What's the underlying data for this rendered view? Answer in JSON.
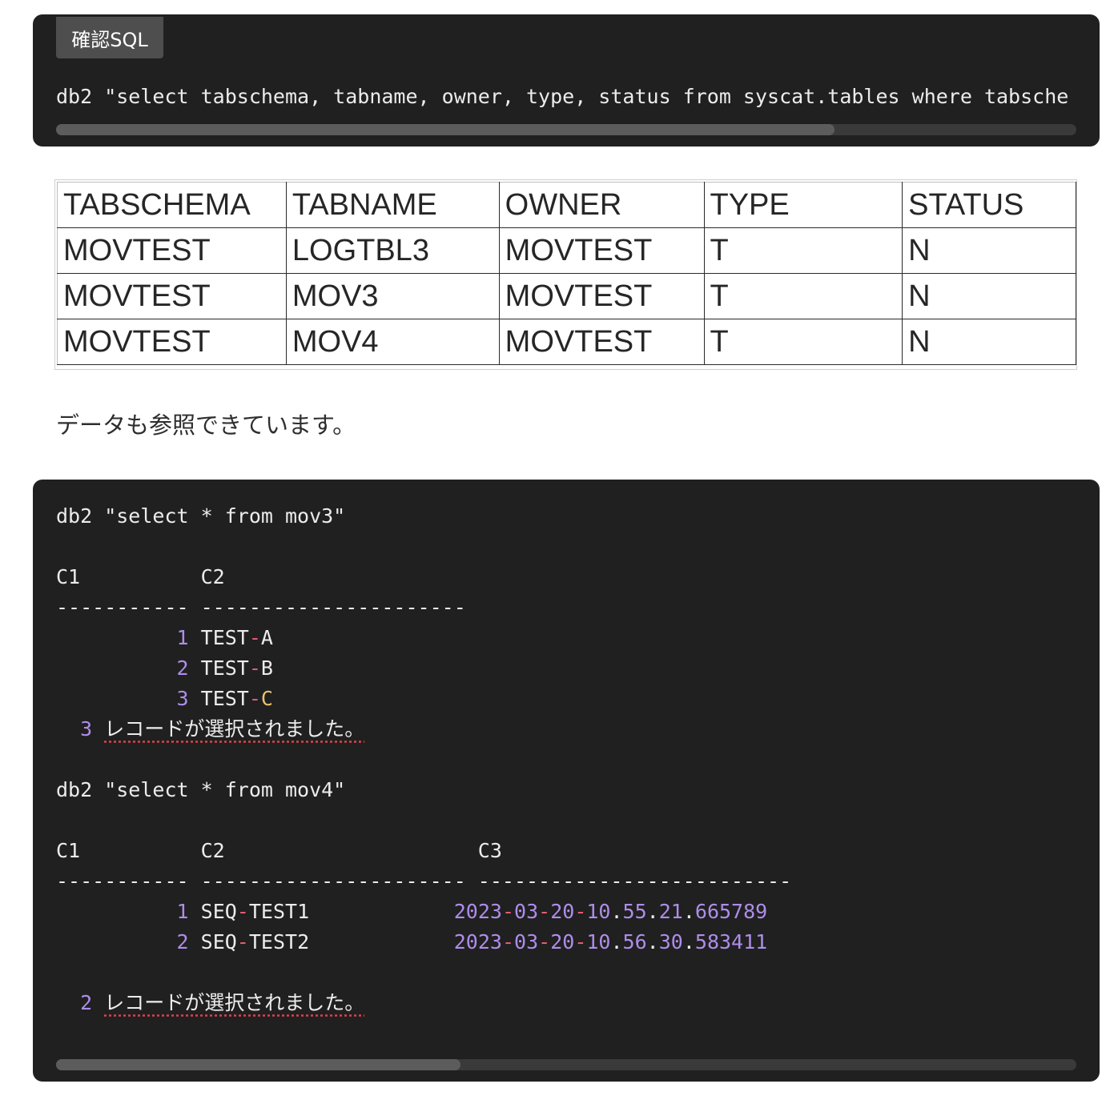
{
  "block1": {
    "label": "確認SQL",
    "code": "db2 \"select tabschema, tabname, owner, type, status from syscat.tables where tabsche"
  },
  "result_table": {
    "headers": [
      "TABSCHEMA",
      "TABNAME",
      "OWNER",
      "TYPE",
      "STATUS"
    ],
    "rows": [
      [
        "MOVTEST",
        "LOGTBL3",
        "MOVTEST",
        "T",
        "N"
      ],
      [
        "MOVTEST",
        "MOV3",
        "MOVTEST",
        "T",
        "N"
      ],
      [
        "MOVTEST",
        "MOV4",
        "MOVTEST",
        "T",
        "N"
      ]
    ]
  },
  "note": "データも参照できています。",
  "block2": {
    "query1": "db2 \"select * from mov3\"",
    "q1_header": "C1          C2",
    "q1_rule": "----------- ----------------------",
    "q1_rows": [
      {
        "num": "1",
        "prefix": "TEST",
        "suffix": "A"
      },
      {
        "num": "2",
        "prefix": "TEST",
        "suffix": "B"
      },
      {
        "num": "3",
        "prefix": "TEST",
        "suffix": "C"
      }
    ],
    "q1_count": "3",
    "q1_msg": "レコードが選択されました。",
    "query2": "db2 \"select * from mov4\"",
    "q2_header": "C1          C2                     C3",
    "q2_rule": "----------- ---------------------- --------------------------",
    "q2_rows": [
      {
        "num": "1",
        "c2a": "SEQ",
        "c2b": "TEST1",
        "d1": "2023",
        "d2": "03",
        "d3": "20",
        "d4": "10",
        "d5": "55",
        "d6": "21",
        "d7": "665789"
      },
      {
        "num": "2",
        "c2a": "SEQ",
        "c2b": "TEST2",
        "d1": "2023",
        "d2": "03",
        "d3": "20",
        "d4": "10",
        "d5": "56",
        "d6": "30",
        "d7": "583411"
      }
    ],
    "q2_count": "2",
    "q2_msg": "レコードが選択されました。"
  },
  "colors": {
    "code_bg": "#202020",
    "code_text": "#ececec",
    "number": "#ae8dea",
    "operator": "#e65c74",
    "identifier": "#e9c36d"
  }
}
